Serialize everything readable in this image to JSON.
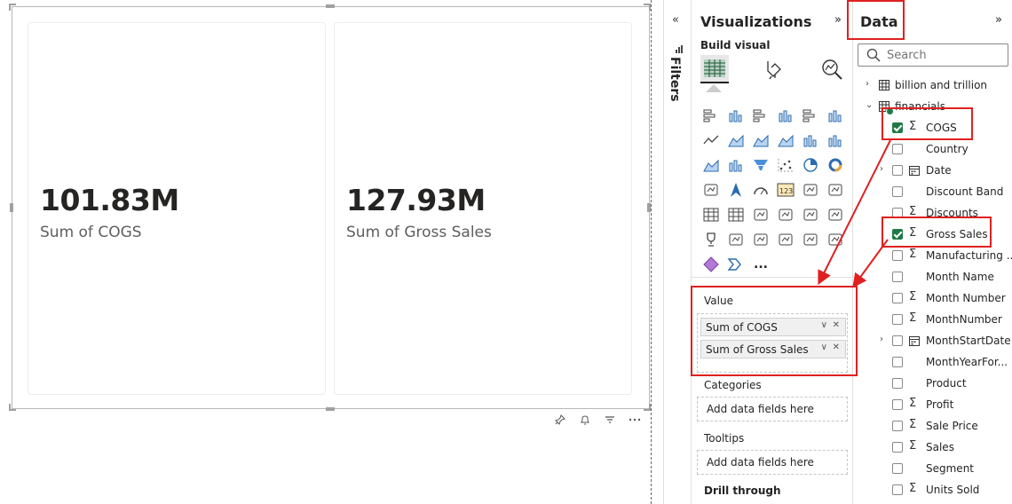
{
  "cards": [
    {
      "value": "101.83M",
      "label": "Sum of COGS"
    },
    {
      "value": "127.93M",
      "label": "Sum of Gross Sales"
    }
  ],
  "filters": {
    "label": "Filters",
    "collapse_glyph": "«"
  },
  "visualizations": {
    "title": "Visualizations",
    "expand_glyph": "»",
    "build_label": "Build visual",
    "more_glyph": "...",
    "value_well": {
      "label": "Value",
      "fields": [
        "Sum of COGS",
        "Sum of Gross Sales"
      ]
    },
    "categories_label": "Categories",
    "categories_placeholder": "Add data fields here",
    "tooltips_label": "Tooltips",
    "tooltips_placeholder": "Add data fields here",
    "drill_label": "Drill through"
  },
  "data": {
    "title": "Data",
    "expand_glyph": "»",
    "search_placeholder": "Search",
    "tables": [
      {
        "name": "billion and trillion"
      },
      {
        "name": "financials"
      }
    ],
    "fields": [
      {
        "name": "COGS",
        "sigma": true,
        "checked": true
      },
      {
        "name": "Country",
        "sigma": false,
        "checked": false
      },
      {
        "name": "Date",
        "sigma": false,
        "checked": false,
        "calendar": true,
        "expandable": true
      },
      {
        "name": "Discount Band",
        "sigma": false,
        "checked": false
      },
      {
        "name": "Discounts",
        "sigma": true,
        "checked": false
      },
      {
        "name": "Gross Sales",
        "sigma": true,
        "checked": true
      },
      {
        "name": "Manufacturing ...",
        "sigma": true,
        "checked": false
      },
      {
        "name": "Month Name",
        "sigma": false,
        "checked": false
      },
      {
        "name": "Month Number",
        "sigma": true,
        "checked": false
      },
      {
        "name": "MonthNumber",
        "sigma": true,
        "checked": false
      },
      {
        "name": "MonthStartDate",
        "sigma": false,
        "checked": false,
        "calendar": true,
        "expandable": true
      },
      {
        "name": "MonthYearFor...",
        "sigma": false,
        "checked": false
      },
      {
        "name": "Product",
        "sigma": false,
        "checked": false
      },
      {
        "name": "Profit",
        "sigma": true,
        "checked": false
      },
      {
        "name": "Sale Price",
        "sigma": true,
        "checked": false
      },
      {
        "name": "Sales",
        "sigma": true,
        "checked": false
      },
      {
        "name": "Segment",
        "sigma": false,
        "checked": false
      },
      {
        "name": "Units Sold",
        "sigma": true,
        "checked": false
      }
    ]
  },
  "colors": {
    "accent_green": "#1f7a47",
    "annotation_red": "#e02020"
  }
}
